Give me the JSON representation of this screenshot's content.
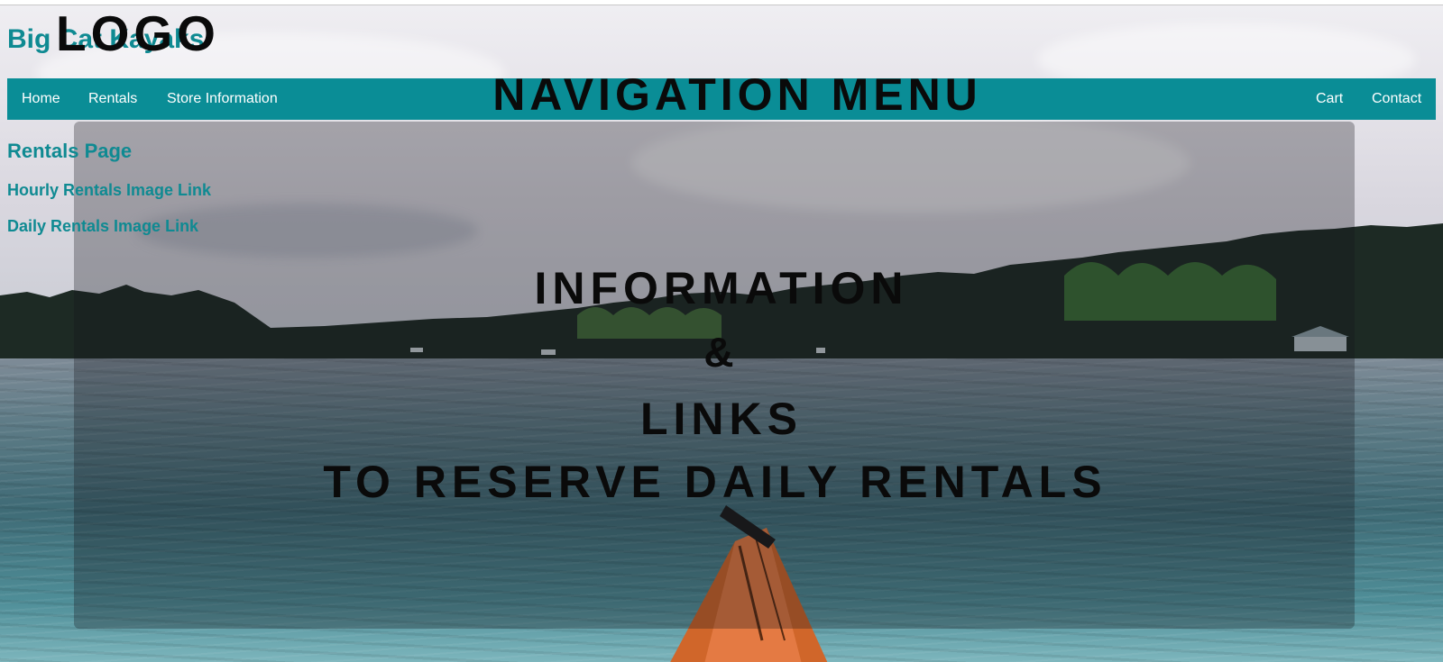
{
  "header": {
    "site_title": "Big Cat Kayaks",
    "logo_label": "LOGO"
  },
  "nav": {
    "left_items": [
      "Home",
      "Rentals",
      "Store Information"
    ],
    "right_items": [
      "Cart",
      "Contact"
    ],
    "overlay_label": "NAVIGATION MENU",
    "bar_color": "#0a8d96"
  },
  "content": {
    "page_heading": "Rentals Page",
    "links": [
      "Hourly Rentals Image Link",
      "Daily Rentals Image Link"
    ],
    "link_color": "#0f8a92"
  },
  "center_block": {
    "line1": "INFORMATION",
    "line2": "&",
    "line3": "LINKS",
    "line4": "TO RESERVE DAILY RENTALS"
  },
  "background": {
    "icon": "lake-kayak-photo"
  }
}
